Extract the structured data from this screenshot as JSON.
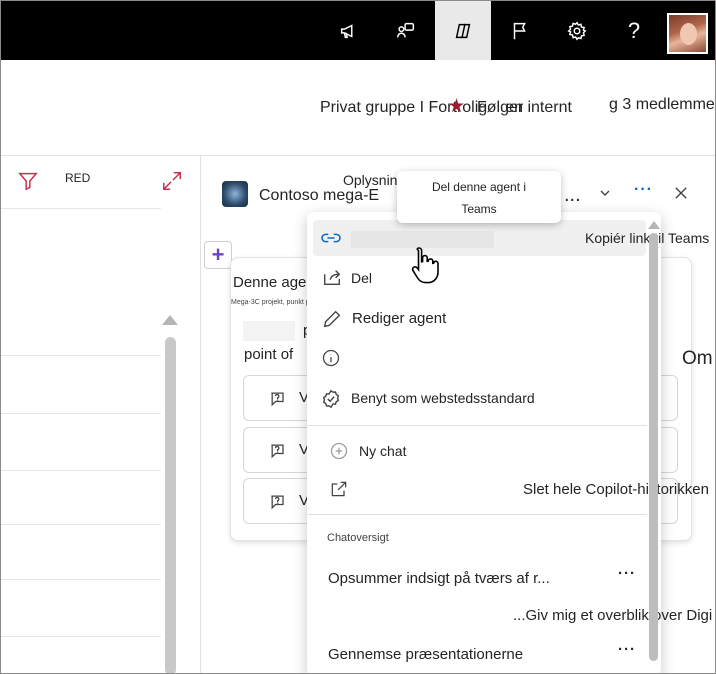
{
  "topbar": {
    "icons": [
      "megaphone-icon",
      "feedback-icon",
      "copilot-icon",
      "flag-icon",
      "settings-icon",
      "help-icon"
    ],
    "help_glyph": "?",
    "active_icon": "copilot-icon"
  },
  "header": {
    "privat": "Privat gruppe I Fortrolig",
    "folger": "Følger",
    "internt": "en internt",
    "members": "g 3 medlemmer"
  },
  "left": {
    "filter_label": "RED"
  },
  "panel": {
    "agent_name": "Contoso mega-E",
    "info_label": "Oplysninger",
    "more_dots": "...",
    "blue_dots": "···",
    "plus": "+"
  },
  "card": {
    "title": "Denne agent",
    "subtitle": "Mega-3C projekt, punkt på",
    "project": "project",
    "point_of": "point of",
    "om": "Om",
    "suggestion_v": "V"
  },
  "tooltip": {
    "line1": "Del denne agent i",
    "line2": "Teams"
  },
  "menu": {
    "copy_link": "Kopiér link til Teams",
    "share": "Del",
    "edit": "Rediger agent",
    "set_default": "Benyt som webstedsstandard",
    "new_chat": "Ny chat",
    "delete_history": "Slet hele Copilot-historikken",
    "section_title": "Chatoversigt",
    "history": [
      "Opsummer indsigt på tværs af r...",
      "...Giv mig et overblik over Digi",
      "Gennemse præsentationerne"
    ],
    "dots": "···"
  }
}
